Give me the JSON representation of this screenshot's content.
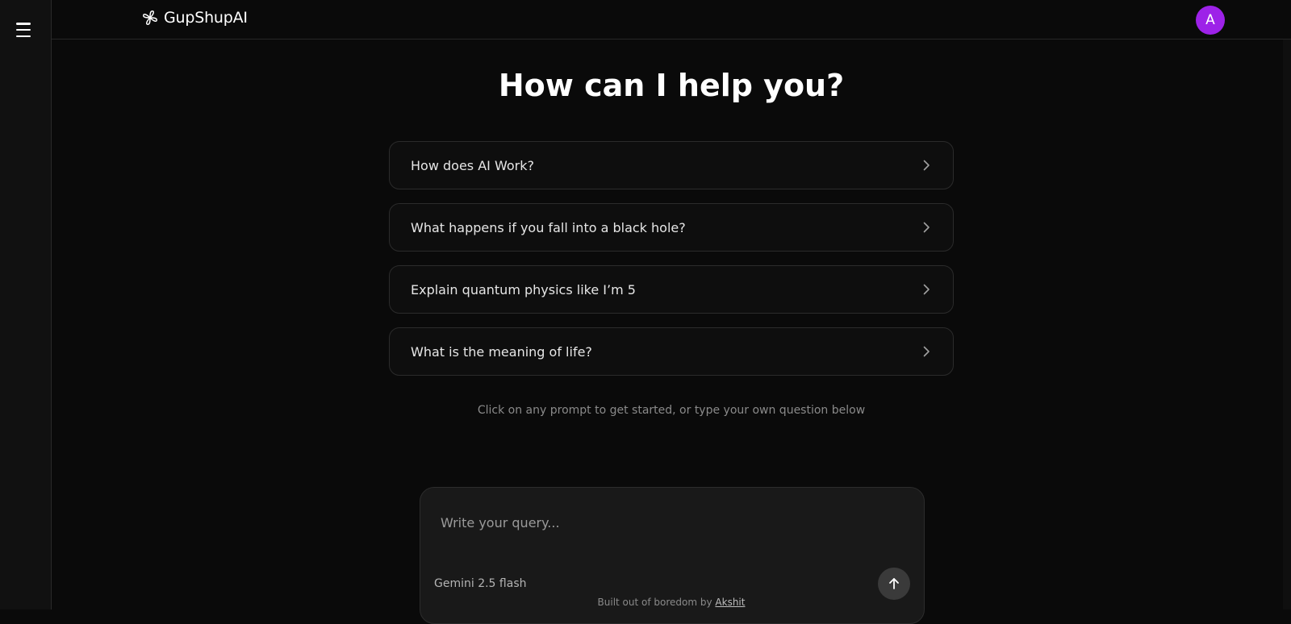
{
  "app": {
    "name": "GupShupAI",
    "avatar_initial": "A",
    "avatar_color": "#9d22e8",
    "accent_color": "#9d22e8"
  },
  "icons": {
    "menu": "hamburger-menu-icon",
    "logo": "linked-loops-logo-icon",
    "chevron": "chevron-right-icon",
    "send": "arrow-up-icon"
  },
  "main": {
    "heading": "How can I help you?",
    "prompts": [
      {
        "label": "How does AI Work?"
      },
      {
        "label": "What happens if you fall into a black hole?"
      },
      {
        "label": "Explain quantum physics like I’m 5"
      },
      {
        "label": "What is the meaning of life?"
      }
    ],
    "hint": "Click on any prompt to get started, or type your own question below"
  },
  "composer": {
    "placeholder": "Write your query...",
    "value": "",
    "model": "Gemini 2.5 flash"
  },
  "footer": {
    "text": "Built out of boredom by ",
    "author": "Akshit"
  }
}
